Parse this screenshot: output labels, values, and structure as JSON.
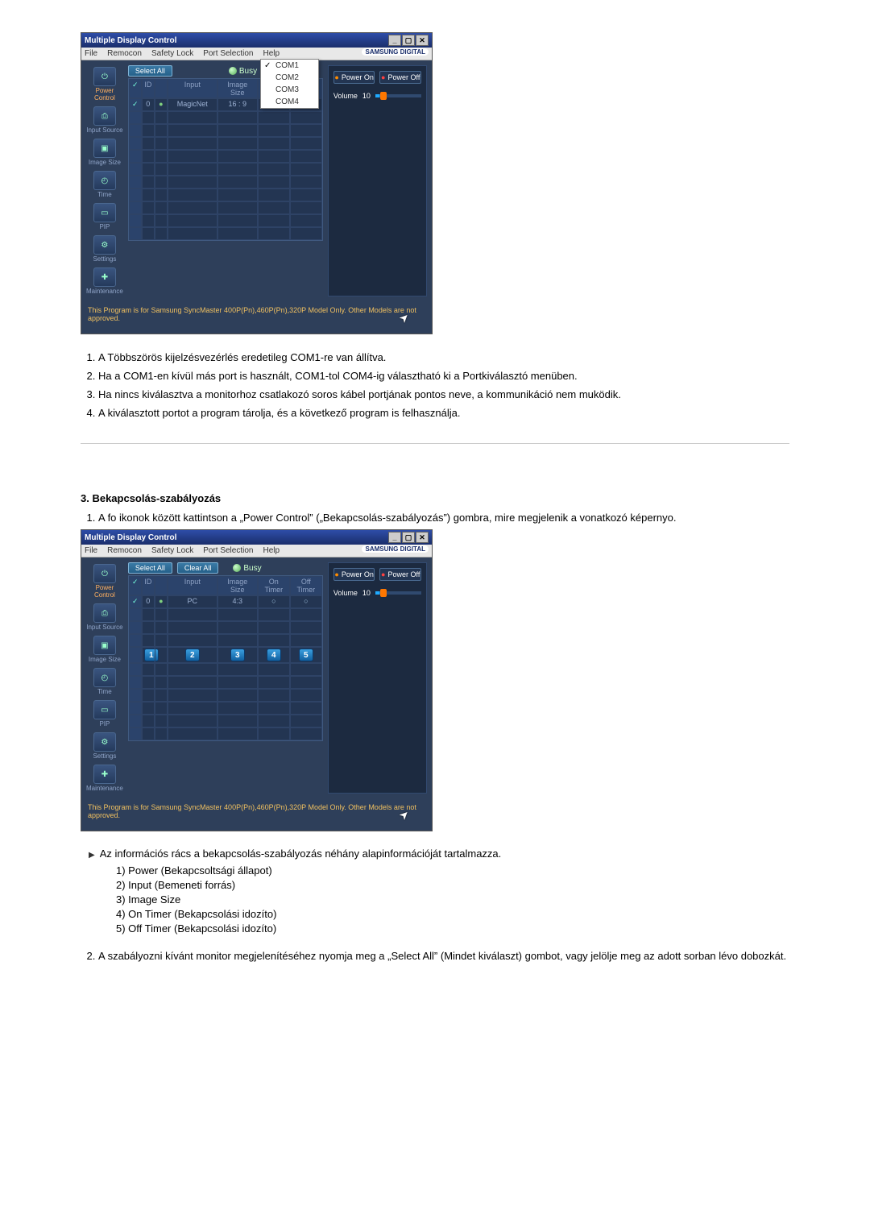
{
  "app": {
    "title": "Multiple Display Control",
    "brand": "SAMSUNG DIGITAL",
    "menu": {
      "file": "File",
      "remocon": "Remocon",
      "safety": "Safety Lock",
      "port": "Port Selection",
      "help": "Help"
    },
    "portOptions": {
      "com1": "COM1",
      "com2": "COM2",
      "com3": "COM3",
      "com4": "COM4"
    },
    "sidebar": {
      "power": "Power Control",
      "input": "Input Source",
      "imgsize": "Image Size",
      "time": "Time",
      "pip": "PIP",
      "settings": "Settings",
      "maint": "Maintenance"
    },
    "toolbar": {
      "selectAll": "Select All",
      "clearAll": "Clear All",
      "busy": "Busy"
    },
    "grid": {
      "id": "ID",
      "input": "Input",
      "imgsize": "Image Size",
      "ontimer": "On Timer",
      "offtimer": "Off Timer",
      "blank": "",
      "val_id": "0",
      "val_input_a": "MagicNet",
      "val_size_a": "16 : 9",
      "val_input_b": "PC",
      "val_size_b": "4:3"
    },
    "right": {
      "powerOn": "Power On",
      "powerOff": "Power Off",
      "volume": "Volume",
      "volumeVal": "10"
    },
    "footer": "This Program is for Samsung SyncMaster 400P(Pn),460P(Pn),320P  Model Only. Other Models are not approved."
  },
  "text": {
    "list1": {
      "i1": "A Többszörös kijelzésvezérlés eredetileg COM1-re van állítva.",
      "i2": "Ha a COM1-en kívül más port is használt, COM1-tol COM4-ig választható ki a Portkiválasztó menüben.",
      "i3": "Ha nincs kiválasztva a monitorhoz csatlakozó soros kábel portjának pontos neve, a kommunikáció nem muködik.",
      "i4": "A kiválasztott portot a program tárolja, és a következő program is felhasználja."
    },
    "sectionTitle": "3. Bekapcsolás-szabályozás",
    "list2_1": "A fo ikonok között kattintson a „Power Control” („Bekapcsolás-szabályozás”) gombra, mire megjelenik a vonatkozó képernyo.",
    "bullet": "Az információs rács a bekapcsolás-szabályozás néhány alapinformációját tartalmazza.",
    "sub": {
      "s1": "1) Power (Bekapcsoltsági állapot)",
      "s2": "2) Input (Bemeneti forrás)",
      "s3": "3) Image Size",
      "s4": "4) On Timer (Bekapcsolási idozíto)",
      "s5": "5) Off Timer (Bekapcsolási idozíto)"
    },
    "list2_2": "A szabályozni kívánt monitor megjelenítéséhez nyomja meg a „Select All” (Mindet kiválaszt) gombot, vagy jelölje meg az adott sorban lévo dobozkát."
  },
  "badges": {
    "b1": "1",
    "b2": "2",
    "b3": "3",
    "b4": "4",
    "b5": "5"
  }
}
